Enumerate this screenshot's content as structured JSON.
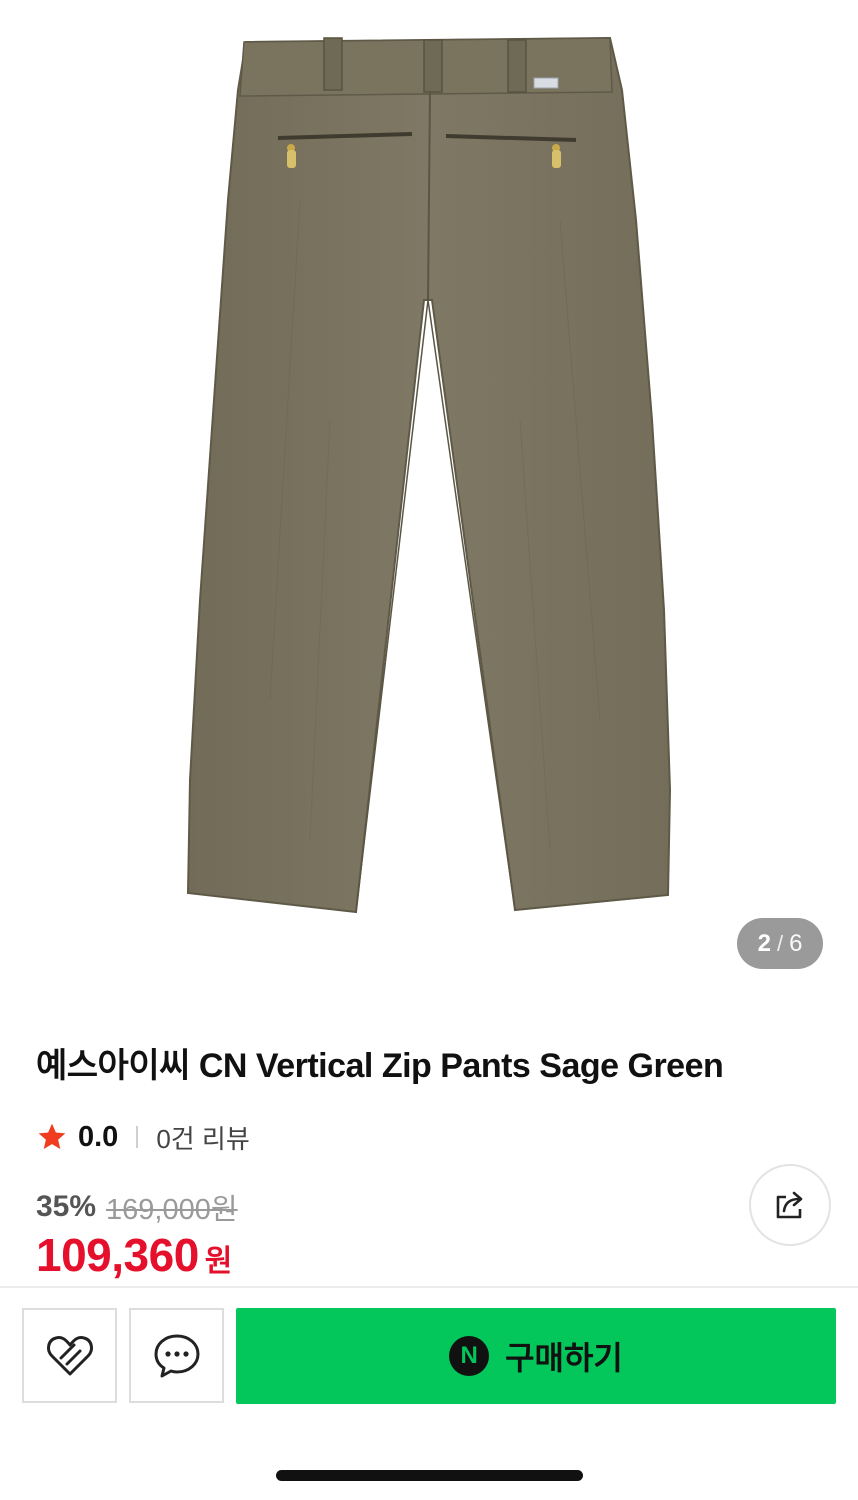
{
  "gallery": {
    "current": "2",
    "separator": "/",
    "total": "6",
    "image_alt": "pants-back-view"
  },
  "product": {
    "title": "예스아이씨 CN Vertical Zip Pants Sage Green"
  },
  "rating": {
    "score": "0.0",
    "reviews": "0건 리뷰"
  },
  "pricing": {
    "discount_rate": "35%",
    "original_price": "169,000원",
    "sale_price": "109,360",
    "currency": "원"
  },
  "actions": {
    "share_icon": "share-icon",
    "like_icon": "heart-icon",
    "chat_icon": "chat-icon",
    "buy_badge": "N",
    "buy_label": "구매하기"
  },
  "colors": {
    "sale_red": "#e5102b",
    "naver_green": "#03c75a",
    "pants_fabric": "#7d7762"
  }
}
